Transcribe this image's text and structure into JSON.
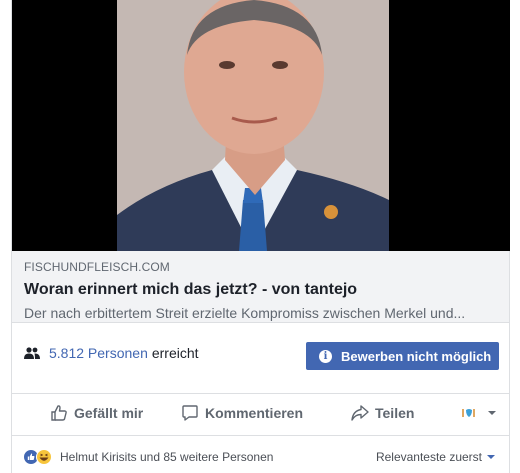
{
  "link_preview": {
    "domain": "FISCHUNDFLEISCH.COM",
    "headline": "Woran erinnert mich das jetzt? - von tantejo",
    "description": "Der nach erbittertem Streit erzielte Kompromiss zwischen Merkel und..."
  },
  "reach": {
    "count": "5.812 Personen",
    "suffix": "erreicht"
  },
  "boost_button": {
    "label": "Bewerben nicht möglich"
  },
  "actions": {
    "like": "Gefällt mir",
    "comment": "Kommentieren",
    "share": "Teilen"
  },
  "reactions": {
    "names": "Helmut Kirisits und 85 weitere Personen",
    "sort_label": "Relevanteste zuerst"
  },
  "colors": {
    "accent": "#4267b2",
    "text_secondary": "#606770",
    "preview_bg": "#f2f3f5"
  }
}
